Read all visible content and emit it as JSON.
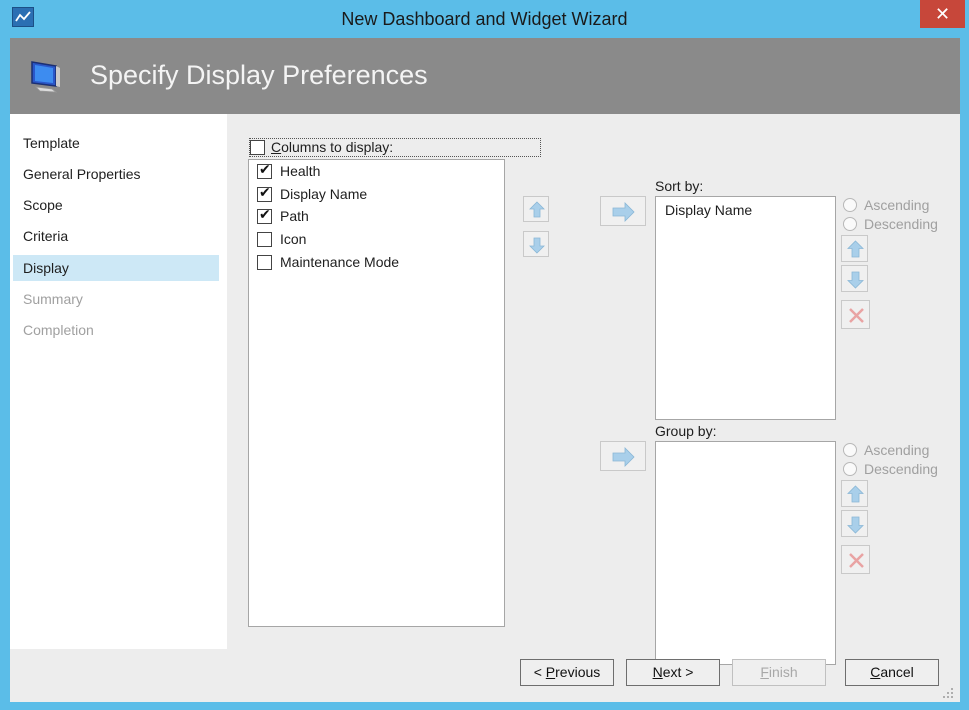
{
  "window": {
    "title": "New Dashboard and Widget Wizard",
    "close_glyph": "✕"
  },
  "header": {
    "title": "Specify Display Preferences",
    "icon": "monitor-icon"
  },
  "sidebar": {
    "items": [
      {
        "label": "Template",
        "state": "normal"
      },
      {
        "label": "General Properties",
        "state": "normal"
      },
      {
        "label": "Scope",
        "state": "normal"
      },
      {
        "label": "Criteria",
        "state": "normal"
      },
      {
        "label": "Display",
        "state": "selected"
      },
      {
        "label": "Summary",
        "state": "disabled"
      },
      {
        "label": "Completion",
        "state": "disabled"
      }
    ]
  },
  "columns": {
    "header_label": "Columns to display:",
    "header_checked": false,
    "items": [
      {
        "label": "Health",
        "checked": true
      },
      {
        "label": "Display Name",
        "checked": true
      },
      {
        "label": "Path",
        "checked": true
      },
      {
        "label": "Icon",
        "checked": false
      },
      {
        "label": "Maintenance Mode",
        "checked": false
      }
    ]
  },
  "sort": {
    "label": "Sort by:",
    "items": [
      "Display Name"
    ],
    "ascending_label": "Ascending",
    "descending_label": "Descending"
  },
  "group": {
    "label": "Group by:",
    "items": [],
    "ascending_label": "Ascending",
    "descending_label": "Descending"
  },
  "footer": {
    "previous_label": "< Previous",
    "next_label": "Next >",
    "finish_label": "Finish",
    "cancel_label": "Cancel"
  },
  "colors": {
    "titlebar": "#5bbde8",
    "header_band": "#8a8a8a",
    "selection": "#cde8f6",
    "close": "#c7473a"
  }
}
